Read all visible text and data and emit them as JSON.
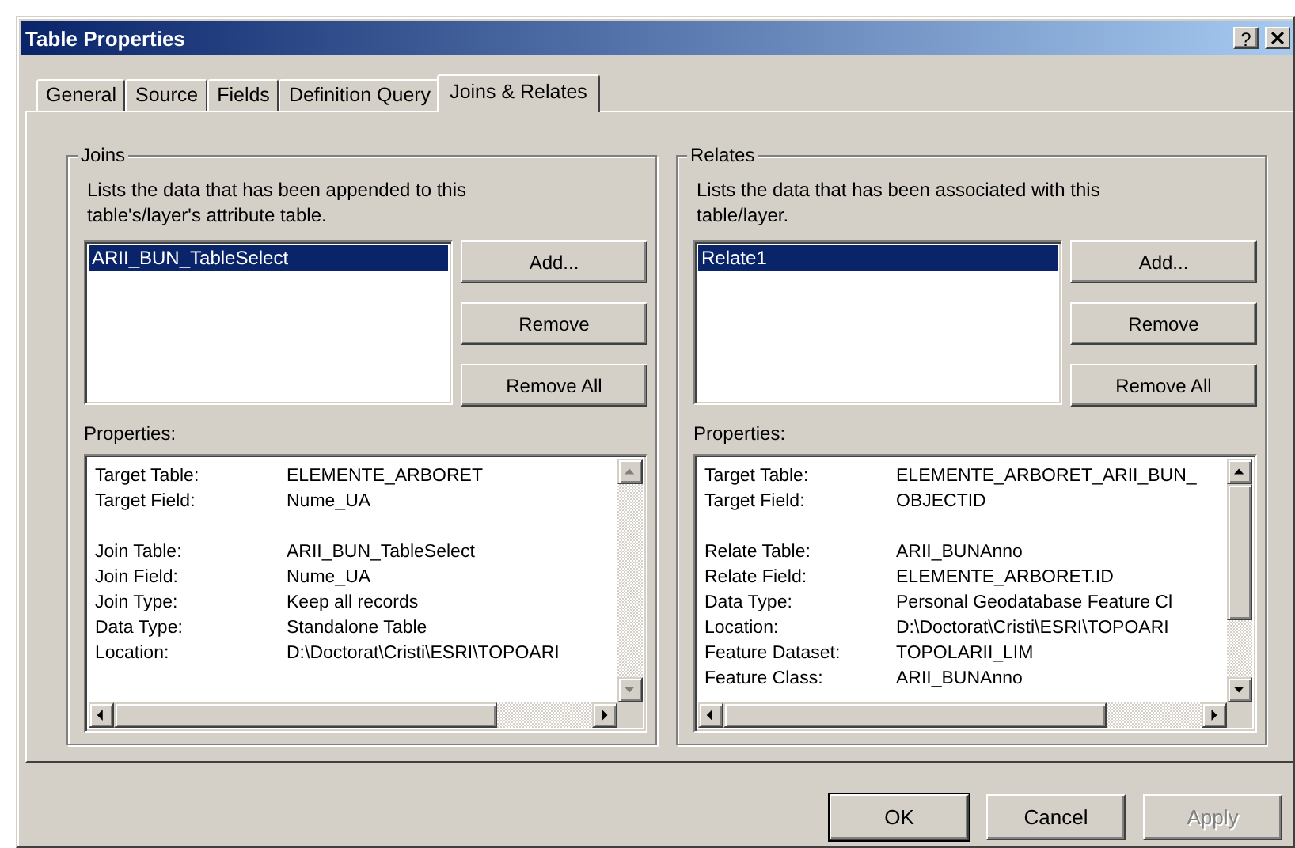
{
  "window": {
    "title": "Table Properties",
    "help": "?"
  },
  "tabs": [
    {
      "label": "General",
      "selected": false
    },
    {
      "label": "Source",
      "selected": false
    },
    {
      "label": "Fields",
      "selected": false
    },
    {
      "label": "Definition Query",
      "selected": false
    },
    {
      "label": "Joins & Relates",
      "selected": true
    }
  ],
  "groups": [
    {
      "title": "Joins",
      "description": "Lists the data that has been appended to this\ntable's/layer's attribute table.",
      "items": [
        {
          "label": "ARII_BUN_TableSelect",
          "selected": true
        }
      ],
      "buttons": [
        {
          "label": "Add..."
        },
        {
          "label": "Remove"
        },
        {
          "label": "Remove All"
        }
      ],
      "properties_label": "Properties:",
      "properties": [
        [
          {
            "name": "Target Table:",
            "value": "ELEMENTE_ARBORET"
          },
          {
            "name": "Target Field:",
            "value": "Nume_UA"
          }
        ],
        [
          {
            "name": "Join Table:",
            "value": "ARII_BUN_TableSelect"
          },
          {
            "name": "Join Field:",
            "value": "Nume_UA"
          },
          {
            "name": "Join Type:",
            "value": "Keep all records"
          },
          {
            "name": "Data Type:",
            "value": "Standalone Table"
          },
          {
            "name": "Location:",
            "value": "D:\\Doctorat\\Cristi\\ESRI\\TOPOARI"
          }
        ]
      ]
    },
    {
      "title": "Relates",
      "description": "Lists the data that has been associated with this\ntable/layer.",
      "items": [
        {
          "label": "Relate1",
          "selected": true
        }
      ],
      "buttons": [
        {
          "label": "Add..."
        },
        {
          "label": "Remove"
        },
        {
          "label": "Remove All"
        }
      ],
      "properties_label": "Properties:",
      "properties": [
        [
          {
            "name": "Target Table:",
            "value": "ELEMENTE_ARBORET_ARII_BUN_"
          },
          {
            "name": "Target Field:",
            "value": "OBJECTID"
          }
        ],
        [
          {
            "name": "Relate Table:",
            "value": "ARII_BUNAnno"
          },
          {
            "name": "Relate Field:",
            "value": "ELEMENTE_ARBORET.ID"
          },
          {
            "name": "Data Type:",
            "value": "Personal Geodatabase Feature Cl"
          },
          {
            "name": "Location:",
            "value": "D:\\Doctorat\\Cristi\\ESRI\\TOPOARI"
          },
          {
            "name": "Feature Dataset:",
            "value": "TOPOLARII_LIM"
          },
          {
            "name": "Feature Class:",
            "value": "ARII_BUNAnno"
          }
        ]
      ]
    }
  ],
  "footer_buttons": [
    {
      "label": "OK",
      "default": true,
      "disabled": false
    },
    {
      "label": "Cancel",
      "default": false,
      "disabled": false
    },
    {
      "label": "Apply",
      "default": false,
      "disabled": true
    }
  ]
}
